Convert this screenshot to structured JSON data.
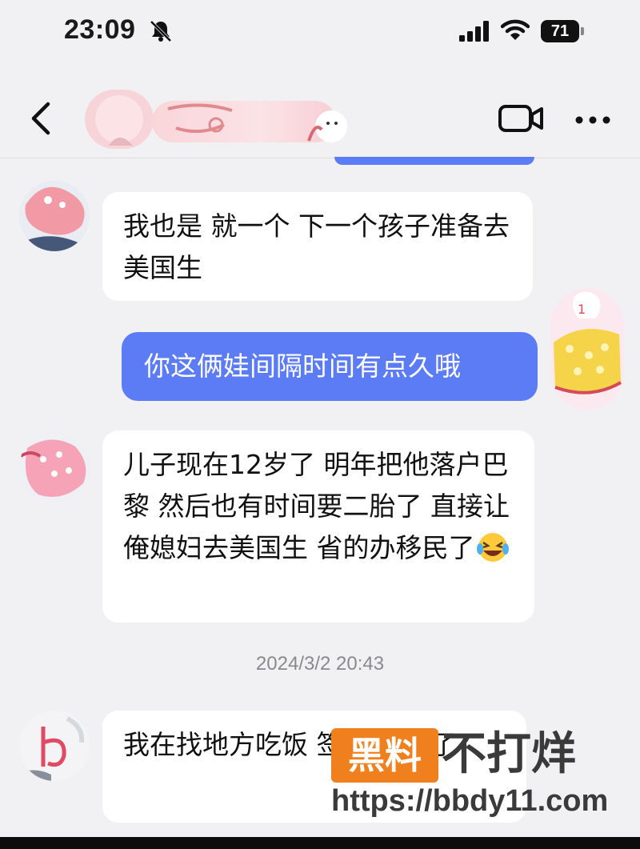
{
  "status_bar": {
    "time": "23:09",
    "battery": "71",
    "icons": [
      "bell-off-icon",
      "signal-icon",
      "wifi-icon",
      "battery-icon"
    ]
  },
  "header": {
    "icons": [
      "back-icon",
      "video-call-icon",
      "more-icon"
    ],
    "contact_name_visible": false
  },
  "messages": [
    {
      "side": "left",
      "text": "我也是 就一个 下一个孩子准备去美国生"
    },
    {
      "side": "right",
      "text": "你这俩娃间隔时间有点久哦"
    },
    {
      "side": "left",
      "text": "儿子现在12岁了 明年把他落户巴黎 然后也有时间要二胎了 直接让俺媳妇去美国生 省的办移民了",
      "emoji": "rolling-laughing-emoji"
    },
    {
      "side": "left",
      "text": "我在找地方吃饭 签到 后背了"
    }
  ],
  "timestamp": "2024/3/2 20:43",
  "watermark": {
    "badge": "黑料",
    "text": "不打烊",
    "url": "https://bbdy11.com"
  },
  "colors": {
    "outgoing_bubble": "#5b7cf5",
    "incoming_bubble": "#ffffff",
    "background": "#f1f1f4",
    "watermark_accent": "#f07f1e"
  }
}
